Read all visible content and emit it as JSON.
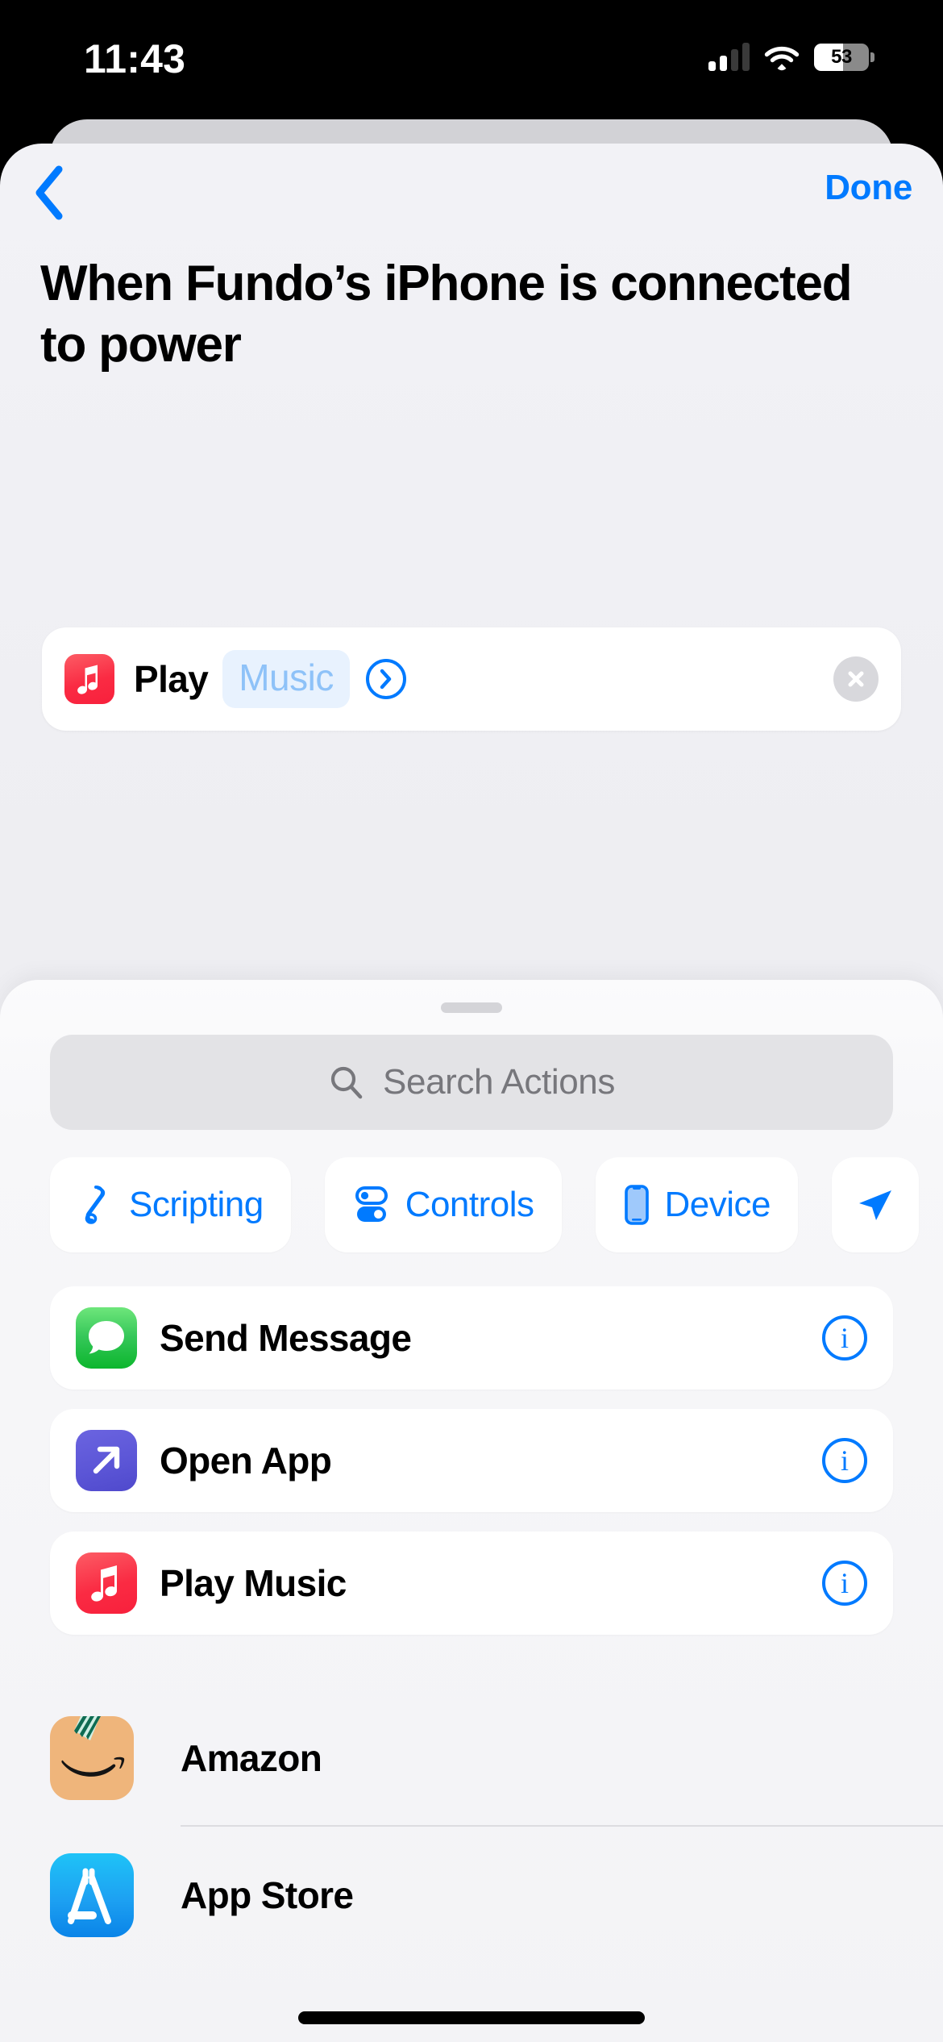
{
  "status_bar": {
    "time": "11:43",
    "battery_percent": "53",
    "battery_level": 53,
    "signal_bars_filled": 2,
    "signal_bars_total": 4,
    "wifi_icon": "wifi-icon",
    "battery_icon": "battery-icon"
  },
  "nav": {
    "back_icon": "chevron-left-icon",
    "done_label": "Done"
  },
  "header": {
    "title": "When Fundo’s iPhone is connected to power"
  },
  "action_card": {
    "app_icon": "apple-music-icon",
    "verb": "Play",
    "token_label": "Music",
    "disclosure_icon": "chevron-right-circle-icon",
    "close_icon": "close-circle-icon"
  },
  "sheet": {
    "grabber": "sheet-grabber",
    "search": {
      "icon": "search-icon",
      "placeholder": "Search Actions",
      "value": ""
    },
    "categories": [
      {
        "label": "Scripting",
        "icon": "scripting-icon"
      },
      {
        "label": "Controls",
        "icon": "controls-toggles-icon"
      },
      {
        "label": "Device",
        "icon": "device-iphone-icon"
      },
      {
        "label": "",
        "icon": "sharing-icon"
      }
    ],
    "actions": [
      {
        "label": "Send Message",
        "icon": "messages-icon",
        "info_icon": "info-circle-icon"
      },
      {
        "label": "Open App",
        "icon": "open-app-icon",
        "info_icon": "info-circle-icon"
      },
      {
        "label": "Play Music",
        "icon": "apple-music-icon",
        "info_icon": "info-circle-icon"
      }
    ],
    "apps": [
      {
        "label": "Amazon",
        "icon": "amazon-icon"
      },
      {
        "label": "App Store",
        "icon": "app-store-icon"
      }
    ]
  },
  "colors": {
    "accent_blue": "#007AFF",
    "token_text": "#8EC2F8",
    "token_bg": "#E8F2FE",
    "music_red": "#FA2B43",
    "messages_green": "#35C759",
    "open_app_purple": "#5B55D6",
    "amazon_tan": "#EFB57B",
    "app_store_blue": "#1DA1F2",
    "page_bg": "#F2F2F6",
    "sheet_bg": "#F7F7F9"
  }
}
